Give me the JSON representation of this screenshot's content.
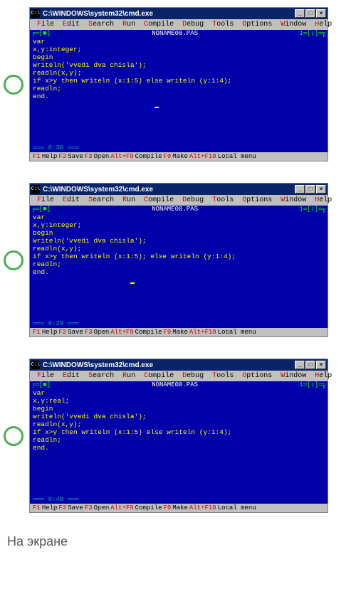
{
  "titlebar": {
    "icon_text": "C:\\",
    "title": "C:\\WINDOWS\\system32\\cmd.exe",
    "min": "_",
    "max": "□",
    "close": "×"
  },
  "menu": {
    "file": "File",
    "edit": "Edit",
    "search": "Search",
    "run": "Run",
    "compile": "Compile",
    "debug": "Debug",
    "tools": "Tools",
    "options": "Options",
    "window": "Window",
    "help": "Help"
  },
  "editor": {
    "left_marker": "╒═[■]",
    "filename": "NONAME00.PAS",
    "right_marker": "1═[↕]═╗"
  },
  "code1": "var\nx,y:integer;\nbegin\nwriteln('vvedi dva chisla');\nreadln(x,y);\nif x>y then writeln (x:1:5) else writeln (y:1:4);\nreadln;\nend.",
  "code2": "var\nx,y:integer;\nbegin\nwriteln('vvedi dva chisla');\nreadln(x,y);\nif x>y then writeln (x:1:5); else writeln (y:1:4);\nreadln;\nend.",
  "code3": "var\nx,y:real;\nbegin\nwriteln('vvedi dva chisla');\nreadln(x,y);\nif x>y then writeln (x:1:5) else writeln (y:1:4);\nreadln;\nend.",
  "cursor_line": "═══ 8:36 ═══",
  "cursor_line2": "═══ 8:29 ═══",
  "cursor_line3": "═══ 6:48 ═══",
  "status": {
    "f1": "F1",
    "f1_label": " Help  ",
    "f2": "F2",
    "f2_label": " Save  ",
    "f3": "F3",
    "f3_label": " Open  ",
    "altf9": "Alt+F9",
    "altf9_label": " Compile  ",
    "f9": "F9",
    "f9_label": " Make  ",
    "altf10": "Alt+F10",
    "altf10_label": " Local menu"
  },
  "bottom_text": "На экране"
}
